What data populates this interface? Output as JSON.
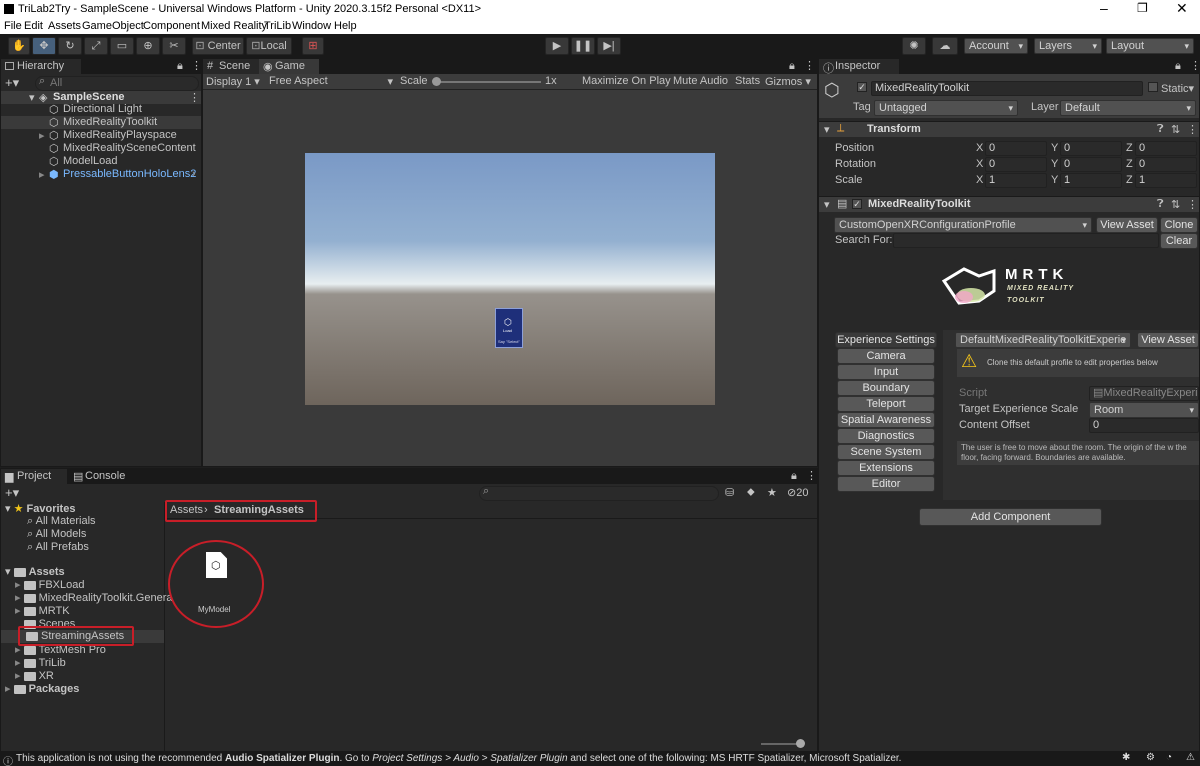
{
  "window": {
    "title": "TriLab2Try - SampleScene - Universal Windows Platform - Unity 2020.3.15f2 Personal <DX11>"
  },
  "menu": [
    "File",
    "Edit",
    "Assets",
    "GameObject",
    "Component",
    "Mixed Reality",
    "TriLib",
    "Window",
    "Help"
  ],
  "toolbar": {
    "center": "Center",
    "local": "Local",
    "account": "Account",
    "layers": "Layers",
    "layout": "Layout"
  },
  "hierarchy": {
    "tab": "Hierarchy",
    "search_placeholder": "All",
    "scene": "SampleScene",
    "items": [
      "Directional Light",
      "MixedRealityToolkit",
      "MixedRealityPlayspace",
      "MixedRealitySceneContent",
      "ModelLoad",
      "PressableButtonHoloLens2"
    ]
  },
  "scene_tabs": {
    "scene": "Scene",
    "game": "Game"
  },
  "game_bar": {
    "display": "Display 1",
    "aspect": "Free Aspect",
    "scale_label": "Scale",
    "scale_value": "1x",
    "maximize": "Maximize On Play",
    "mute": "Mute Audio",
    "stats": "Stats",
    "gizmos": "Gizmos"
  },
  "game_view": {
    "button_label": "Load",
    "button_sub": "Say \"Select\""
  },
  "inspector": {
    "tab": "Inspector",
    "object_name": "MixedRealityToolkit",
    "static": "Static",
    "tag_label": "Tag",
    "tag": "Untagged",
    "layer_label": "Layer",
    "layer": "Default",
    "transform": {
      "title": "Transform",
      "rows": [
        {
          "label": "Position",
          "x": "0",
          "y": "0",
          "z": "0"
        },
        {
          "label": "Rotation",
          "x": "0",
          "y": "0",
          "z": "0"
        },
        {
          "label": "Scale",
          "x": "1",
          "y": "1",
          "z": "1"
        }
      ]
    },
    "mrtk": {
      "title": "MixedRealityToolkit",
      "profile": "CustomOpenXRConfigurationProfile",
      "view_asset": "View Asset",
      "clone": "Clone",
      "search_label": "Search For:",
      "clear": "Clear",
      "logo_title": "MRTK",
      "logo_sub1": "MIXED REALITY",
      "logo_sub2": "TOOLKIT",
      "sections": [
        "Experience Settings",
        "Camera",
        "Input",
        "Boundary",
        "Teleport",
        "Spatial Awareness",
        "Diagnostics",
        "Scene System",
        "Extensions",
        "Editor"
      ],
      "exp_profile": "DefaultMixedRealityToolkitExperie",
      "exp_view_asset": "View Asset",
      "clone_note": "Clone this default profile to edit properties below",
      "script_label": "Script",
      "script_value": "MixedRealityExperien",
      "scale_label": "Target Experience Scale",
      "scale_value": "Room",
      "offset_label": "Content Offset",
      "offset_value": "0",
      "help_text": "The user is free to move about the room. The origin of the w the floor, facing forward. Boundaries are available."
    },
    "add_component": "Add Component"
  },
  "project": {
    "tab_project": "Project",
    "tab_console": "Console",
    "hidden_count": "20",
    "favorites": "Favorites",
    "fav_items": [
      "All Materials",
      "All Models",
      "All Prefabs"
    ],
    "assets": "Assets",
    "asset_items": [
      "FBXLoad",
      "MixedRealityToolkit.Genera",
      "MRTK",
      "Scenes",
      "StreamingAssets",
      "TextMesh Pro",
      "TriLib",
      "XR"
    ],
    "packages": "Packages",
    "breadcrumb": [
      "Assets",
      "StreamingAssets"
    ],
    "file": "MyModel"
  },
  "status": {
    "text_pre": "This application is not using the recommended ",
    "bold1": "Audio Spatializer Plugin",
    "text_mid1": ". Go to ",
    "ital": "Project Settings > Audio > Spatializer Plugin",
    "text_mid2": " and select one of the following: MS HRTF Spatializer, Microsoft Spatializer."
  },
  "colors": {
    "accent_select": "#2c5d87",
    "highlight_red": "#c81e28",
    "prefab_blue": "#7ab9ff"
  }
}
